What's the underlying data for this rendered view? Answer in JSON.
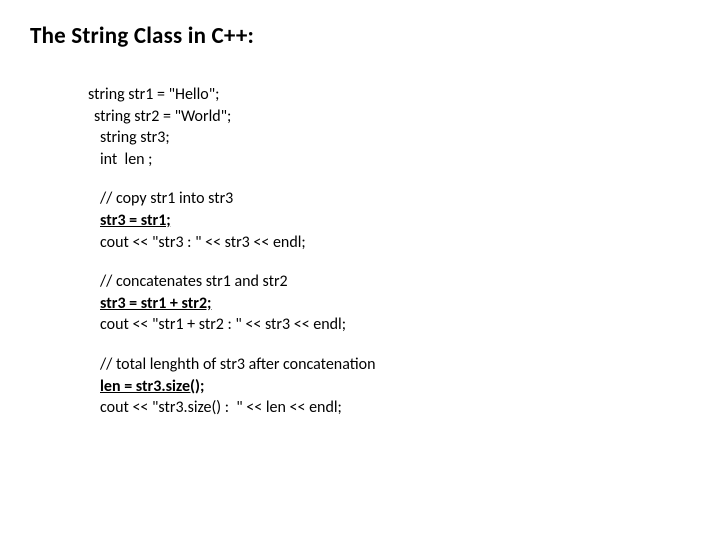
{
  "title": "The String Class in C++:",
  "code": {
    "l1": "string str1 = \"Hello\";",
    "l2": "string str2 = \"World\";",
    "l3": "string str3;",
    "l4": "int  len ;",
    "l5": "// copy str1 into str3",
    "l6": "str3 = str1;",
    "l7": "cout << \"str3 : \" << str3 << endl;",
    "l8": "// concatenates str1 and str2",
    "l9": "str3 = str1 + str2;",
    "l10": "cout << \"str1 + str2 : \" << str3 << endl;",
    "l11": "// total lenghth of str3 after concatenation",
    "l12": "len = str3.size();",
    "l13": "cout << \"str3.size() :  \" << len << endl;"
  }
}
